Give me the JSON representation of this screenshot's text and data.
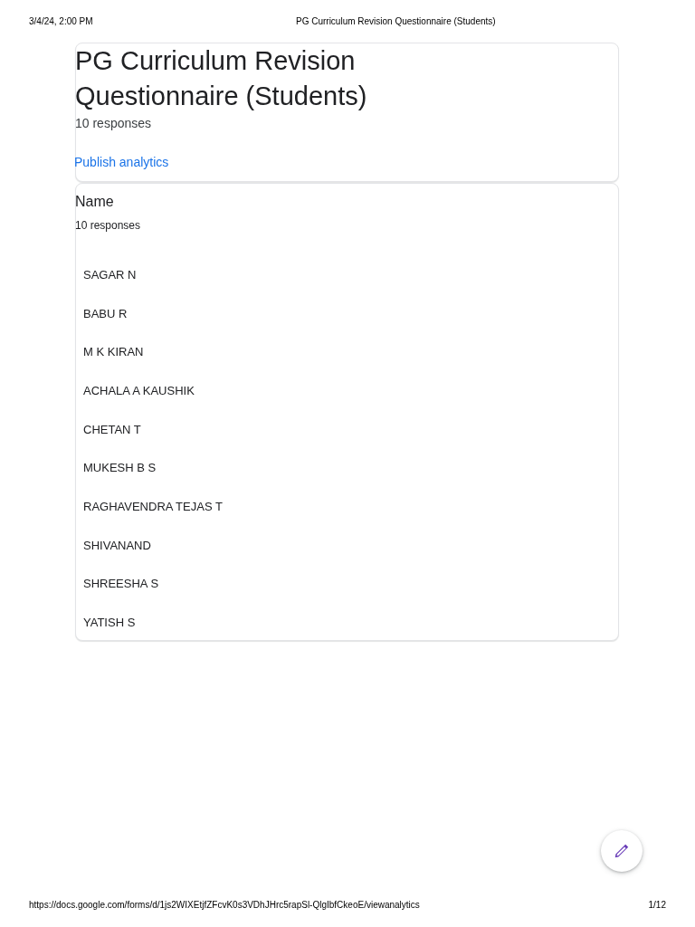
{
  "print_header": {
    "date": "3/4/24, 2:00 PM",
    "title": "PG Curriculum Revision Questionnaire (Students)"
  },
  "form_header": {
    "title": "PG Curriculum Revision Questionnaire (Students)",
    "response_count": "10 responses",
    "publish_link": "Publish analytics"
  },
  "questions": [
    {
      "title": "Name",
      "response_count": "10 responses",
      "responses": [
        "SAGAR N",
        "BABU R",
        "M K KIRAN",
        "ACHALA A KAUSHIK",
        "CHETAN T",
        "MUKESH B S",
        "RAGHAVENDRA TEJAS T",
        "SHIVANAND",
        "SHREESHA S",
        "YATISH S"
      ]
    }
  ],
  "print_footer": {
    "url": "https://docs.google.com/forms/d/1js2WIXEtjfZFcvK0s3VDhJHrc5rapSl-QlgIbfCkeoE/viewanalytics",
    "page": "1/12"
  }
}
